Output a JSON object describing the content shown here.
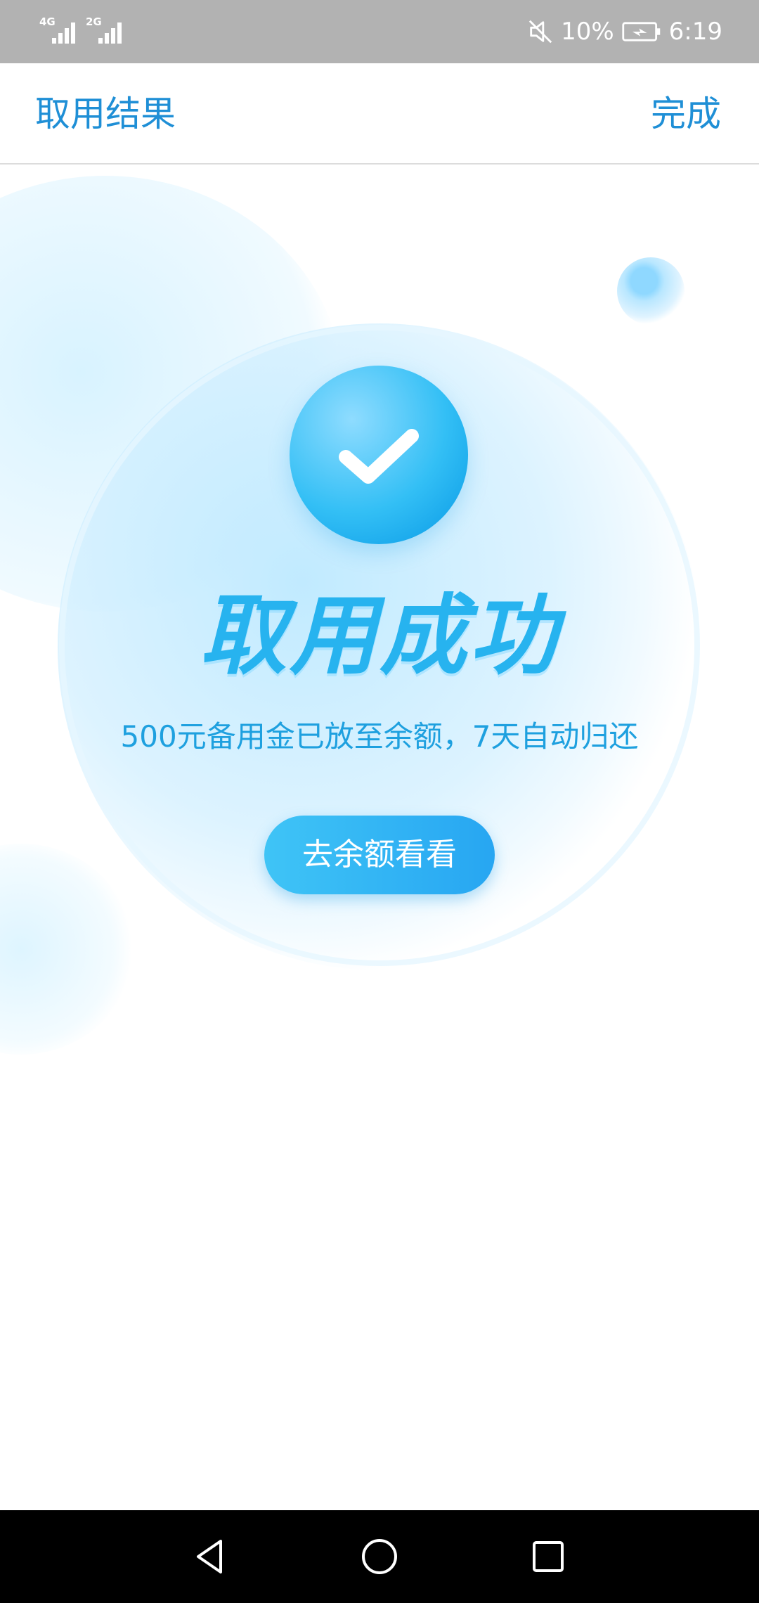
{
  "status_bar": {
    "signal_1_label": "4G",
    "signal_2_label": "2G",
    "battery_percent": "10%",
    "time": "6:19",
    "icons": [
      "signal-icon",
      "mute-icon",
      "battery-charging-icon"
    ]
  },
  "header": {
    "title": "取用结果",
    "done_label": "完成"
  },
  "result": {
    "title": "取用成功",
    "description": "500元备用金已放至余额，7天自动归还",
    "button_label": "去余额看看",
    "icon": "check-icon"
  },
  "nav_bar": {
    "icons": [
      "back-icon",
      "home-icon",
      "recent-apps-icon"
    ]
  },
  "colors": {
    "accent": "#1f8fd6",
    "title_blue": "#27b3ef",
    "button_start": "#3fc4f6",
    "button_end": "#27a6f2",
    "status_bar_bg": "#b2b2b2"
  }
}
